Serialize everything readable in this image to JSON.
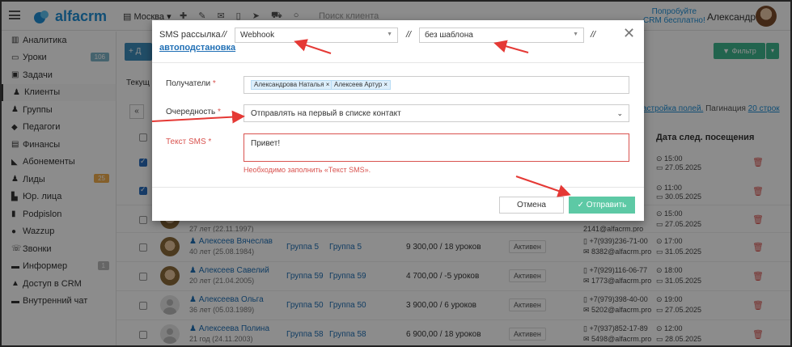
{
  "topbar": {
    "logo_text": "alfacrm",
    "city": "Москва ▾",
    "search_placeholder": "Поиск клиента",
    "promo_line1": "Попробуйте",
    "promo_line2": "CRM бесплатно!",
    "user_name": "Александра"
  },
  "sidebar": {
    "items": [
      {
        "label": "Аналитика",
        "icon": "chart-icon"
      },
      {
        "label": "Уроки",
        "icon": "calendar-icon",
        "badge": "106"
      },
      {
        "label": "Задачи",
        "icon": "task-icon"
      },
      {
        "label": "Клиенты",
        "icon": "user-icon",
        "active": true
      },
      {
        "label": "Группы",
        "icon": "users-icon"
      },
      {
        "label": "Педагоги",
        "icon": "graduation-icon"
      },
      {
        "label": "Финансы",
        "icon": "money-icon"
      },
      {
        "label": "Абонементы",
        "icon": "tag-icon"
      },
      {
        "label": "Лиды",
        "icon": "lead-icon",
        "badge": "25"
      },
      {
        "label": "Юр. лица",
        "icon": "building-icon"
      },
      {
        "label": "Podpislon",
        "icon": "doc-icon"
      },
      {
        "label": "Wazzup",
        "icon": "whatsapp-icon"
      },
      {
        "label": "Звонки",
        "icon": "phone-icon"
      },
      {
        "label": "Информер",
        "icon": "informer-icon",
        "badge": "1"
      },
      {
        "label": "Доступ в CRM",
        "icon": "lock-icon"
      },
      {
        "label": "Внутренний чат",
        "icon": "chat-icon"
      }
    ]
  },
  "main": {
    "add_button": "+ Д",
    "filter_button": "▼ Фильтр",
    "tab_text": "Текущ",
    "pagination_settings": "астройка полей.",
    "pagination_label": "Пагинация",
    "pagination_value": "20 строк",
    "next_visit_header": "Дата след. посещения",
    "side_rows": [
      {
        "time": "⊙ 15:00",
        "date": "▭ 27.05.2025"
      },
      {
        "time": "⊙ 11:00",
        "date": "▭ 30.05.2025"
      }
    ],
    "partial_row": {
      "age": "27 лет (22.11.1997)",
      "email": "2141@alfacrm.pro",
      "time": "⊙ 15:00",
      "date": "▭ 27.05.2025"
    },
    "rows": [
      {
        "name": "Алексеев Вячеслав",
        "age": "40 лет (25.08.1984)",
        "group1": "Группа 5",
        "group2": "Группа 5",
        "balance": "9 300,00 / 18 уроков",
        "status": "Активен",
        "phone": "+7(939)236-71-00",
        "email": "8382@alfacrm.pro",
        "time": "⊙ 17:00",
        "date": "▭ 31.05.2025",
        "photo": true
      },
      {
        "name": "Алексеев Савелий",
        "age": "20 лет (21.04.2005)",
        "group1": "Группа 59",
        "group2": "Группа 59",
        "balance": "4 700,00 / -5 уроков",
        "status": "Активен",
        "phone": "+7(929)116-06-77",
        "email": "1773@alfacrm.pro",
        "time": "⊙ 18:00",
        "date": "▭ 31.05.2025",
        "photo": true
      },
      {
        "name": "Алексеева Ольга",
        "age": "36 лет (05.03.1989)",
        "group1": "Группа 50",
        "group2": "Группа 50",
        "balance": "3 900,00 / 6 уроков",
        "status": "Активен",
        "phone": "+7(979)398-40-00",
        "email": "5202@alfacrm.pro",
        "time": "⊙ 19:00",
        "date": "▭ 27.05.2025",
        "photo": false
      },
      {
        "name": "Алексеева Полина",
        "age": "21 год (24.11.2003)",
        "group1": "Группа 58",
        "group2": "Группа 58",
        "balance": "6 900,00 / 18 уроков",
        "status": "Активен",
        "phone": "+7(937)852-17-89",
        "email": "5498@alfacrm.pro",
        "time": "⊙ 12:00",
        "date": "▭ 28.05.2025",
        "photo": false
      }
    ]
  },
  "modal": {
    "title": "SMS рассылка",
    "sep": "//",
    "gateway_value": "Webhook",
    "template_value": "без шаблона",
    "autosubst_link": "автоподстановка",
    "close": "✕",
    "recipients_label": "Получатели",
    "required_mark": "*",
    "recipients": [
      "Александрова Наталья ×",
      "Алексеев Артур ×"
    ],
    "queue_label": "Очередность",
    "queue_value": "Отправлять на первый в списке контакт",
    "sms_label": "Текст SMS",
    "sms_value": "Привет!",
    "sms_error": "Необходимо заполнить «Текст SMS».",
    "cancel_button": "Отмена",
    "send_button": "✓ Отправить"
  },
  "colors": {
    "accent": "#1f8fd6",
    "send": "#5dc9a5",
    "error": "#d9534f",
    "arrow": "#e53935"
  }
}
